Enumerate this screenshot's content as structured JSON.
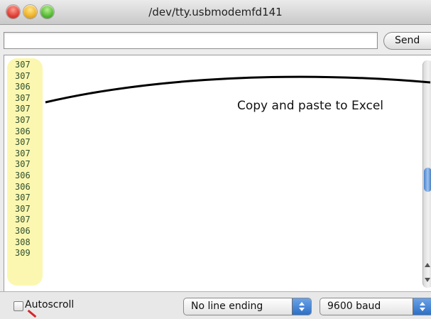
{
  "window": {
    "title": "/dev/tty.usbmodemfd141"
  },
  "toolbar": {
    "input_value": "",
    "send_label": "Send"
  },
  "output": {
    "lines": [
      "307",
      "307",
      "306",
      "307",
      "307",
      "307",
      "306",
      "307",
      "307",
      "307",
      "306",
      "306",
      "307",
      "307",
      "307",
      "306",
      "308",
      "309"
    ]
  },
  "annotation": {
    "text": "Copy and paste to Excel"
  },
  "bottom": {
    "autoscroll_label": "Autoscroll",
    "autoscroll_checked": false,
    "line_ending_value": "No line ending",
    "baud_value": "9600 baud"
  },
  "colors": {
    "highlight": "#fbf6a7",
    "scroll_thumb": "#4a82cc",
    "traffic_close": "#e0443a",
    "traffic_min": "#f1b52c",
    "traffic_zoom": "#5bbd3a"
  }
}
